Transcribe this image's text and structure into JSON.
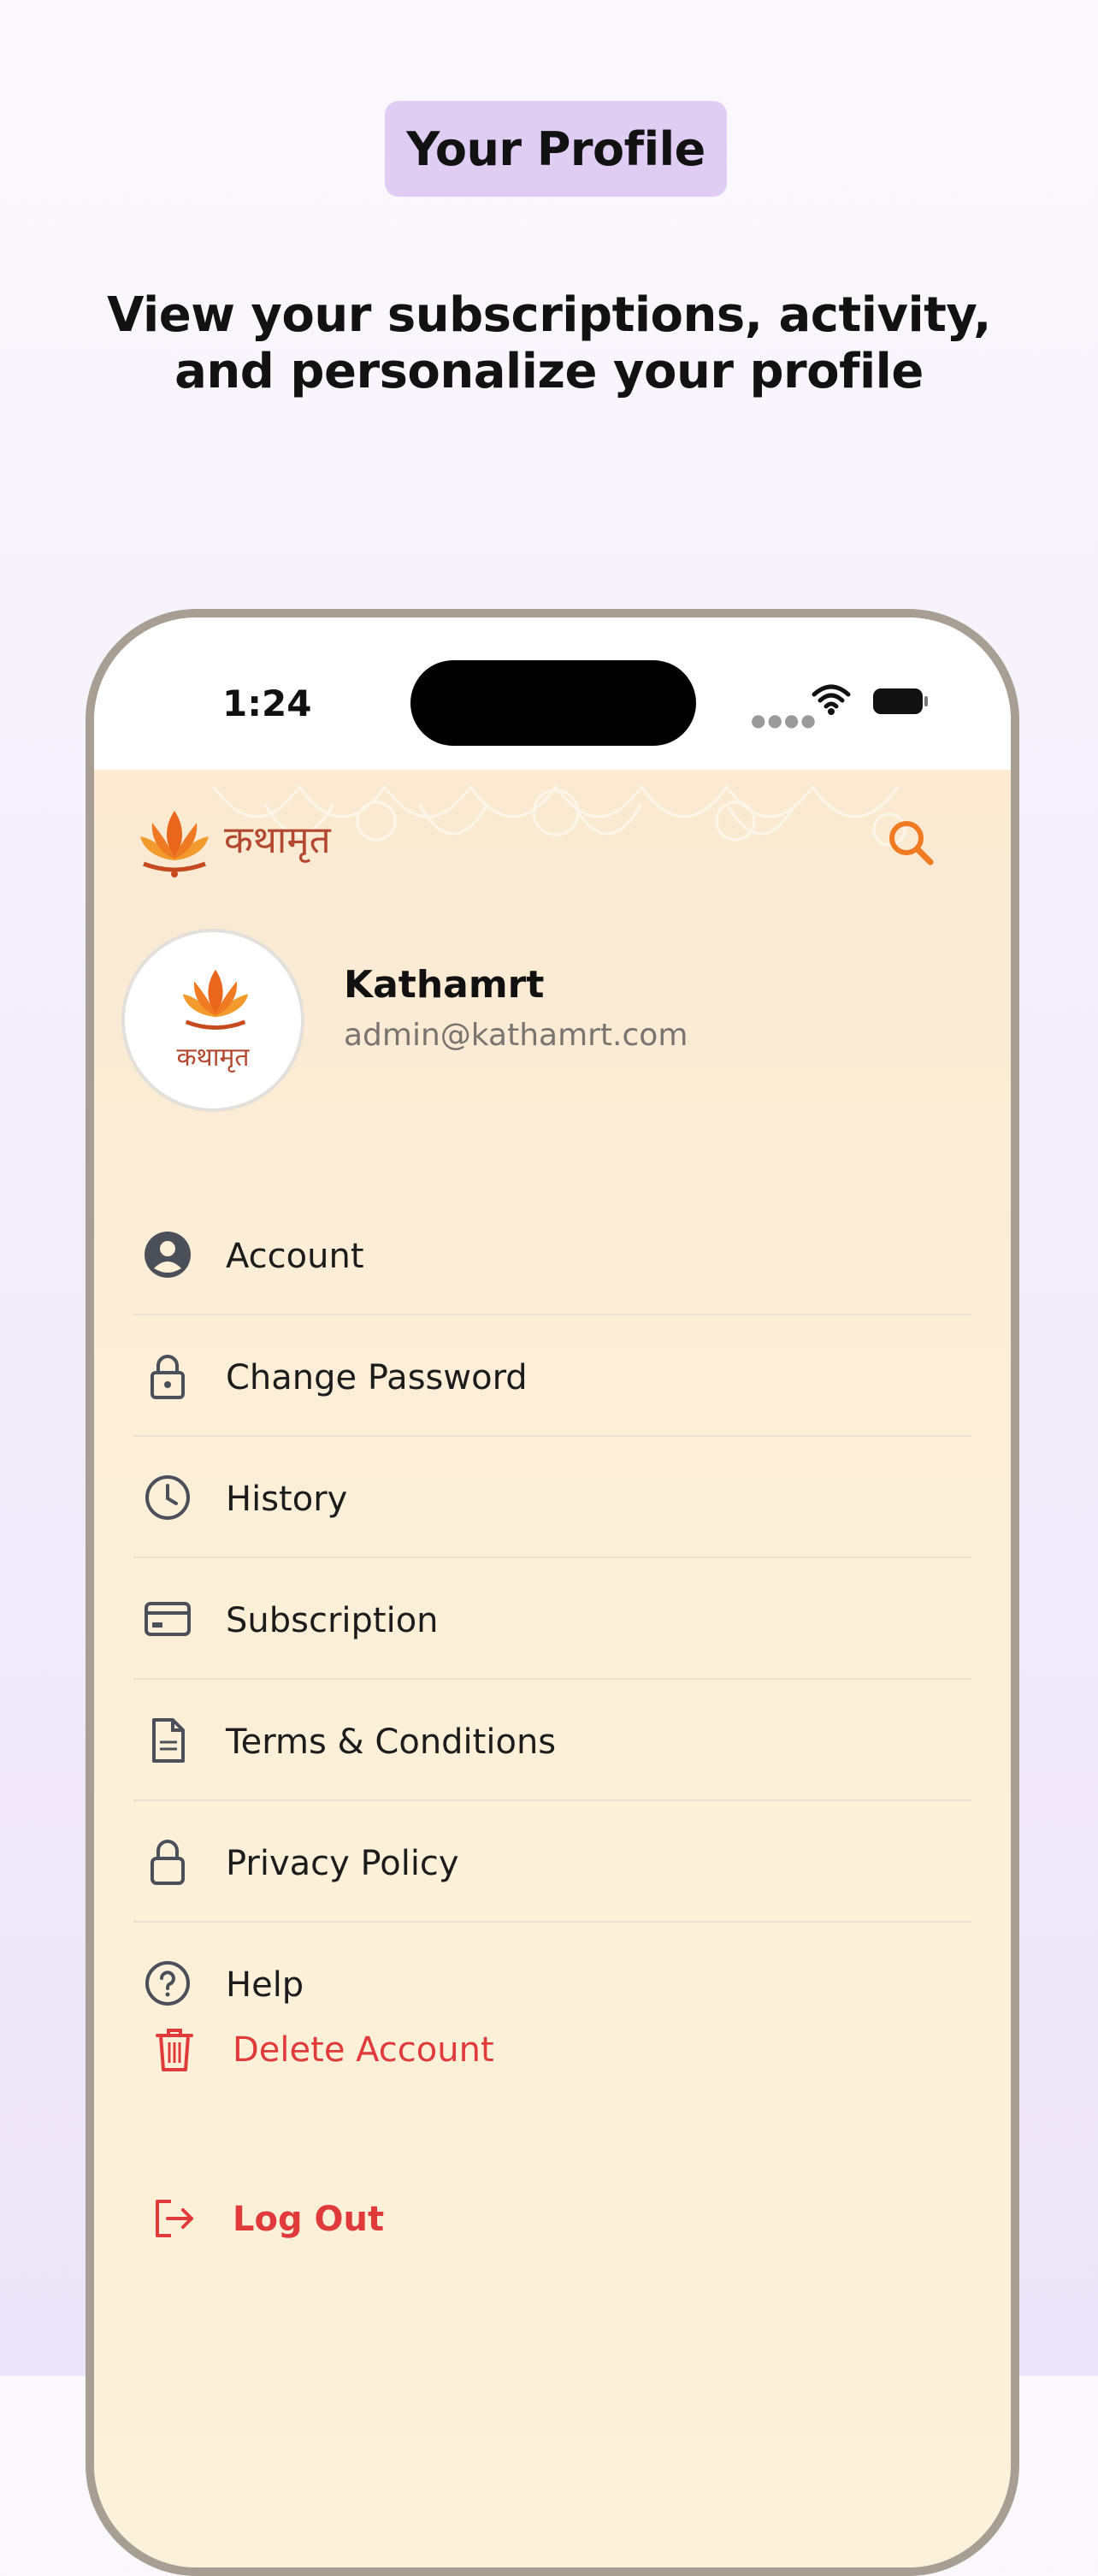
{
  "promo": {
    "badge": "Your Profile",
    "subtitle_line1": "View your subscriptions, activity,",
    "subtitle_line2": "and personalize your profile"
  },
  "status_bar": {
    "time": "1:24"
  },
  "app": {
    "name": "कथामृत",
    "logo_caption": "कथामृत"
  },
  "profile": {
    "name": "Kathamrt",
    "email": "admin@kathamrt.com"
  },
  "menu": [
    {
      "label": "Account",
      "icon": "account-circle-icon"
    },
    {
      "label": "Change Password",
      "icon": "lock-icon"
    },
    {
      "label": "History",
      "icon": "clock-icon"
    },
    {
      "label": "Subscription",
      "icon": "credit-card-icon"
    },
    {
      "label": "Terms & Conditions",
      "icon": "document-icon"
    },
    {
      "label": "Privacy Policy",
      "icon": "padlock-icon"
    },
    {
      "label": "Help",
      "icon": "help-circle-icon"
    }
  ],
  "actions": {
    "delete_account": "Delete Account",
    "log_out": "Log Out"
  },
  "colors": {
    "badge_bg": "#dfcdf4",
    "accent": "#f07a22",
    "danger": "#e03a3a",
    "screen_bg": "#fcefd8"
  }
}
